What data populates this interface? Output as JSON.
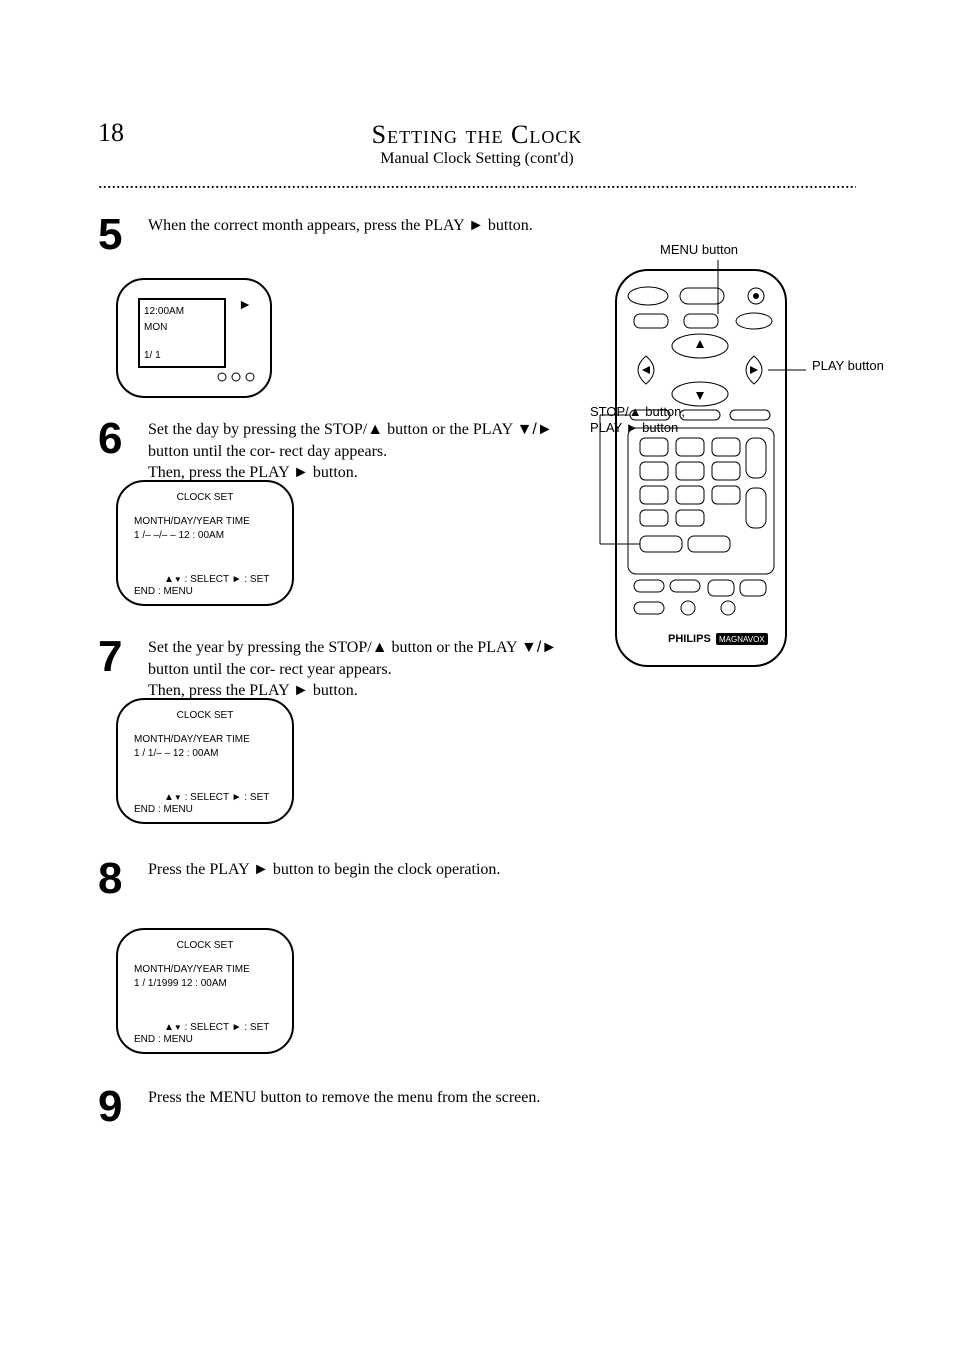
{
  "page_number": "18",
  "header_title": "Setting the Clock",
  "header_subtitle": "Manual Clock Setting (cont'd)",
  "dots": ".........................................................................................................................................................................................",
  "steps": {
    "s5": {
      "num": "5",
      "text_a": "When the correct month appears, press the PLAY ",
      "text_b": " button."
    },
    "s6": {
      "num": "6",
      "text_a_1": "Set the day by pressing the STOP/",
      "text_a_2": " button or the PLAY ",
      "text_b": " button until the cor- rect day appears.",
      "text_c_1": "Then, press the PLAY ",
      "text_c_2": " button."
    },
    "s7": {
      "num": "7",
      "text_a_1": "Set the year by pressing the STOP/",
      "text_a_2": " button or the PLAY ",
      "text_b": " button until the cor- rect year appears.",
      "text_c_1": "Then, press the PLAY ",
      "text_c_2": " button."
    },
    "s8": {
      "num": "8",
      "text_a_1": "Press the PLAY ",
      "text_a_2": " button to begin the clock operation."
    },
    "s9": {
      "num": "9",
      "text_a": "Press the MENU button to remove the menu from the screen."
    }
  },
  "screens": {
    "box1": {
      "header": "CLOCK SET",
      "line1": "MONTH/DAY/YEAR     TIME",
      "line2": "  1  /– –/– –   12 : 00AM",
      "tip_up": "▲",
      "tip_down": "▼",
      "tip_play": "►",
      "tip_select": ": SELECT",
      "tip_set": ": SET",
      "tip_end": "END                   : MENU"
    },
    "box2": {
      "header": "CLOCK SET",
      "line1": "MONTH/DAY/YEAR     TIME",
      "line2": "  1  /  1/– –   12 : 00AM",
      "tip_up": "▲",
      "tip_down": "▼",
      "tip_play": "►",
      "tip_select": ": SELECT",
      "tip_set": ": SET",
      "tip_end": "END                   : MENU"
    },
    "box3": {
      "header": "CLOCK SET",
      "line1": "MONTH/DAY/YEAR     TIME",
      "line2": "  1  /  1/1999  12 : 00AM",
      "tip_up": "▲",
      "tip_down": "▼",
      "tip_play": "►",
      "tip_select": ": SELECT",
      "tip_set": ": SET",
      "tip_end": "END                   : MENU"
    }
  },
  "remote": {
    "brand1": "PHILIPS",
    "brand2": "MAGNAVOX",
    "labels": {
      "menu": "MENU button",
      "play": "PLAY button",
      "stop": "STOP/▲ button,",
      "play2": "PLAY ► button"
    }
  },
  "inset": {
    "line1": "12:00AM",
    "line2": "MON",
    "line3": "1/ 1"
  }
}
